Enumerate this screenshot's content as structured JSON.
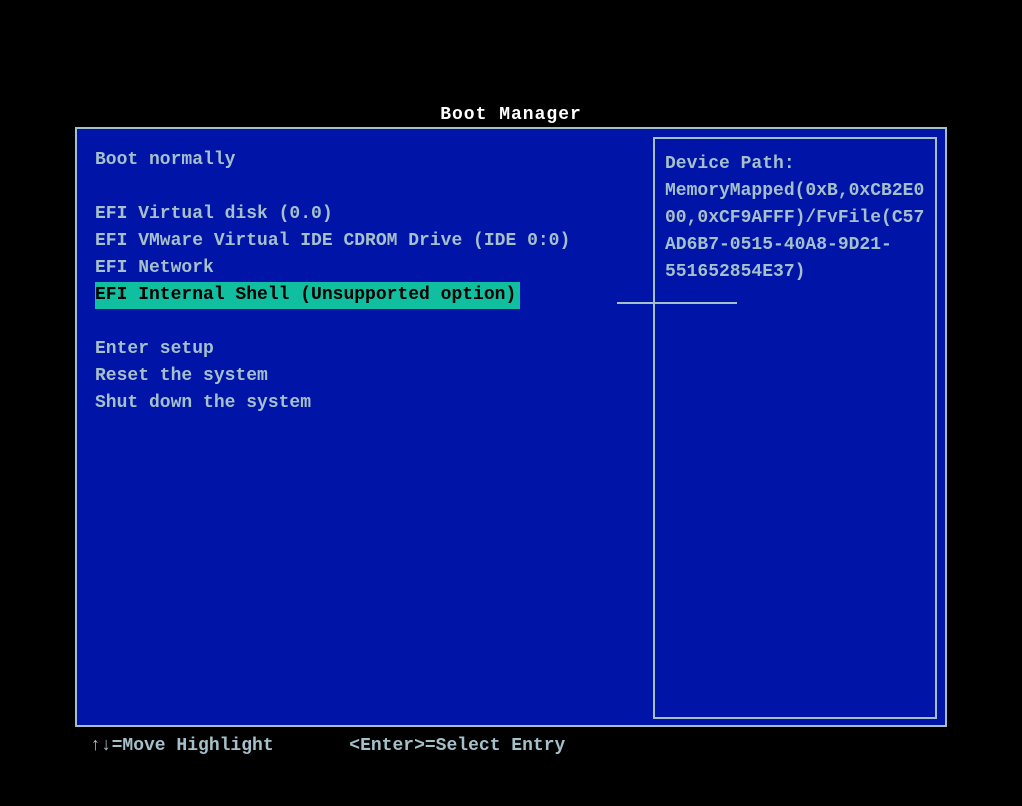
{
  "title": "Boot Manager",
  "menu": {
    "group1": [
      "Boot normally"
    ],
    "group2": [
      "EFI Virtual disk (0.0)",
      "EFI VMware Virtual IDE CDROM Drive (IDE 0:0)",
      "EFI Network",
      "EFI Internal Shell (Unsupported option)"
    ],
    "group3": [
      "Enter setup",
      "Reset the system",
      "Shut down the system"
    ],
    "selected_index": 3
  },
  "info": {
    "label": "Device Path:",
    "value": "MemoryMapped(0xB,0xCB2E000,0xCF9AFFF)/FvFile(C57AD6B7-0515-40A8-9D21-551652854E37)"
  },
  "footer": {
    "move": "↑↓=Move Highlight",
    "select": "<Enter>=Select Entry"
  }
}
